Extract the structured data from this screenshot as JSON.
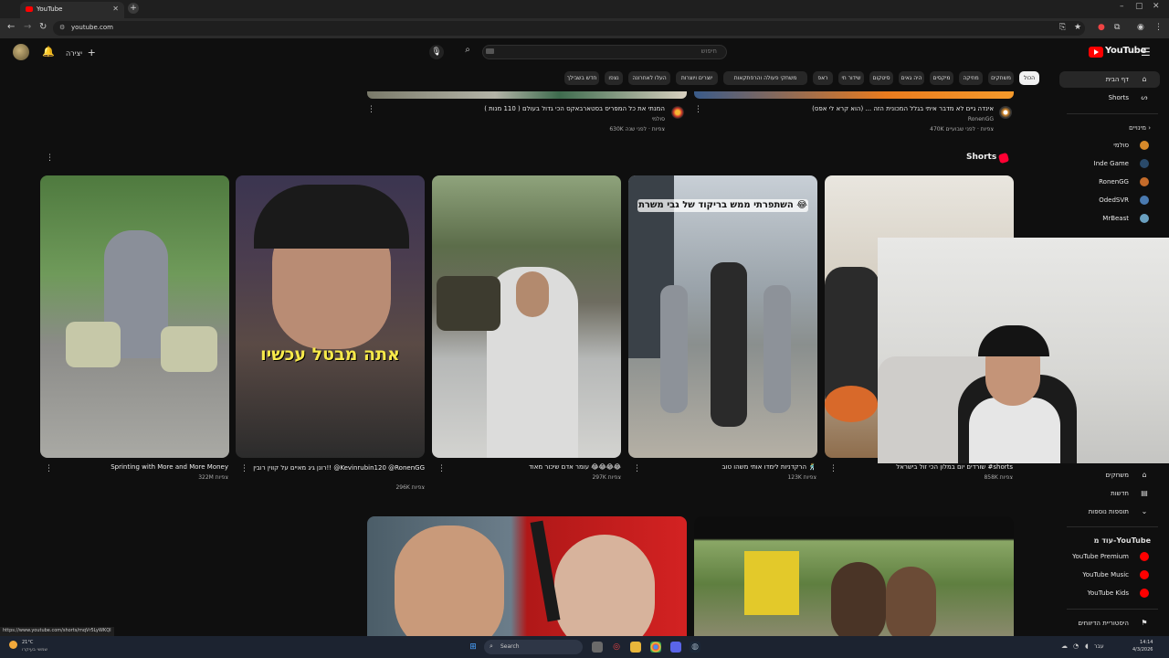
{
  "browser": {
    "tab_title": "YouTube",
    "url": "youtube.com",
    "status_url": "https://www.youtube.com/shorts/mqVr5LyWKQI"
  },
  "header": {
    "logo_text": "YouTube",
    "search_placeholder": "חיפוש",
    "create_label": "יצירה"
  },
  "chips": [
    "הכול",
    "משחקים",
    "מוזיקה",
    "מיקסים",
    "היה גאים",
    "סיטקום",
    "שידור חי",
    "ראפ",
    "משחקי פעולה והרפתקאות",
    "יוצרים ויוצרות",
    "העלו לאחרונה",
    "נצפו",
    "חדש בשבילך"
  ],
  "sidebar": {
    "home": "דף הבית",
    "shorts": "Shorts",
    "subs_header": "מינויים",
    "subs": [
      "סולמי",
      "Inde Game",
      "RonenGG",
      "OdedSVR",
      "MrBeast"
    ],
    "explore": [
      {
        "label": "משחקים",
        "icon": "gamepad-icon"
      },
      {
        "label": "חדשות",
        "icon": "news-icon"
      },
      {
        "label": "תוספות נוספות",
        "icon": "chevron-down-icon"
      }
    ],
    "more_header": "עוד מ-YouTube",
    "more": [
      "YouTube Premium",
      "YouTube Music",
      "YouTube Kids"
    ],
    "history": "היסטוריית הדיווחים"
  },
  "top_videos": [
    {
      "title": "אינדה גיים לא מדבר איתי בגלל המכונית הזה ... (הוא קרא לי אפס)",
      "channel": "RonenGG",
      "meta": "470K צפיות · לפני שבועיים"
    },
    {
      "title": "המנתי את כל המפריס בסטארבאקס הכי גדול בעולם ( 110 מנות )",
      "channel": "סולמי",
      "meta": "630K צפיות · לפני שנה"
    }
  ],
  "shorts": {
    "section_title": "Shorts",
    "items": [
      {
        "title": "Sprinting with More and More Money",
        "views": "322M צפיות"
      },
      {
        "title": "רונן גיג מאיים על קווין רובין!! @Kevinrubin120 @RonenGG",
        "views": "296K צפיות",
        "overlay": "אתה מבטל עכשיו"
      },
      {
        "title": "עומר אדם שיכור מאוד 😂😂😂😂",
        "views": "297K צפיות"
      },
      {
        "title": "הרקדניות לימדו אותי משהו טוב 🕺",
        "views": "123K צפיות",
        "overlay": "השתפרתי ממש בריקוד של גבי משרת 😂"
      },
      {
        "title": "שורדים יום במלון הכי זול בישראל #shorts",
        "views": "858K צפיות"
      }
    ]
  },
  "taskbar": {
    "search": "Search",
    "weather_temp": "21°C",
    "weather_desc": "שמשי בעיקרו",
    "time": "14:14",
    "date": "4/3/2026",
    "lang": "עבר"
  },
  "colors": {
    "brand": "#ff0000",
    "bg": "#0f0f0f",
    "chip": "#272727"
  }
}
